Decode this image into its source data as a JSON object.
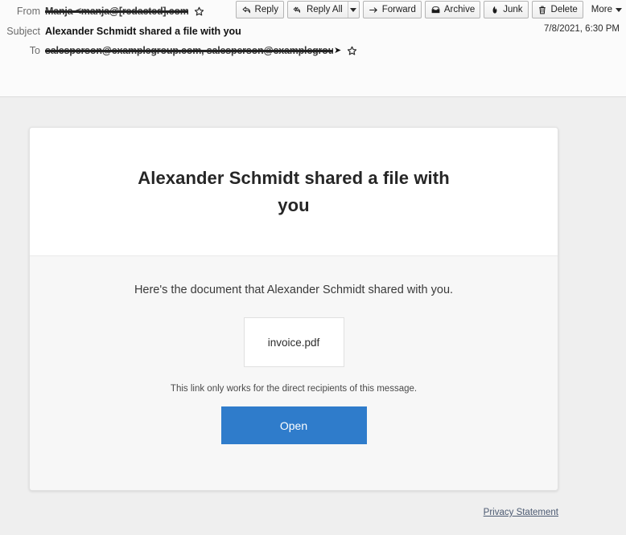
{
  "header": {
    "from_label": "From",
    "from_value": "Manja <manja@[redacted].com>",
    "from_redacted": true,
    "subject_label": "Subject",
    "subject_value": "Alexander Schmidt shared a file with you",
    "to_label": "To",
    "to_value": "salesperson@examplegroup.com, salesperson@examplegroup.com",
    "to_redacted": true,
    "to_expand": "➤",
    "date": "7/8/2021, 6:30 PM",
    "star_icon": "star-icon"
  },
  "toolbar": {
    "buttons": [
      {
        "label": "Reply",
        "icon": "reply-arrow-icon",
        "has_dropdown": false
      },
      {
        "label": "Reply All",
        "icon": "reply-all-arrow-icon",
        "has_dropdown": true
      },
      {
        "label": "Forward",
        "icon": "forward-arrow-icon",
        "has_dropdown": false
      },
      {
        "label": "Archive",
        "icon": "archive-box-icon",
        "has_dropdown": false
      },
      {
        "label": "Junk",
        "icon": "junk-flame-icon",
        "has_dropdown": false
      },
      {
        "label": "Delete",
        "icon": "trash-can-icon",
        "has_dropdown": false
      },
      {
        "label": "More",
        "icon": "chevron-down-icon",
        "has_dropdown": true
      }
    ]
  },
  "message": {
    "card_title": "Alexander Schmidt shared a file with you",
    "intro_text": "Here's the document that Alexander Schmidt shared with you.",
    "file_name": "invoice.pdf",
    "fineprint": "This link only works for the direct recipients of this message.",
    "open_button_label": "Open",
    "privacy_link_label": "Privacy Statement"
  },
  "colors": {
    "accent_blue": "#2f7ccb",
    "page_background": "#efefef",
    "card_background": "#ffffff",
    "card_body_background": "#f7f7f7",
    "link_color": "#4c5a72"
  }
}
